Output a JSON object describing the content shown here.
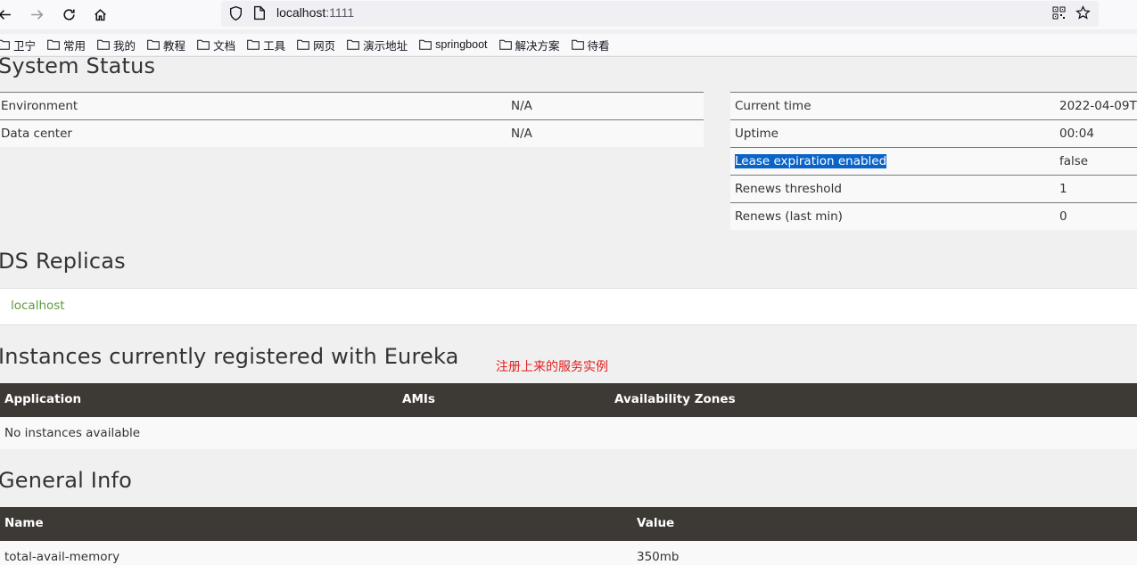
{
  "browser": {
    "url_host": "localhost",
    "url_port": ":1111",
    "bookmarks": [
      "卫宁",
      "常用",
      "我的",
      "教程",
      "文档",
      "工具",
      "网页",
      "演示地址",
      "springboot",
      "解决方案",
      "待看"
    ]
  },
  "system_status": {
    "title": "System Status",
    "left_rows": [
      {
        "key": "Environment",
        "value": "N/A"
      },
      {
        "key": "Data center",
        "value": "N/A"
      }
    ],
    "right_rows": [
      {
        "key": "Current time",
        "value": "2022-04-09T"
      },
      {
        "key": "Uptime",
        "value": "00:04"
      },
      {
        "key": "Lease expiration enabled",
        "value": "false"
      },
      {
        "key": "Renews threshold",
        "value": "1"
      },
      {
        "key": "Renews (last min)",
        "value": "0"
      }
    ]
  },
  "replicas": {
    "title": "DS Replicas",
    "items": [
      "localhost"
    ]
  },
  "instances": {
    "title": "Instances currently registered with Eureka",
    "annotation": "注册上来的服务实例",
    "columns": [
      "Application",
      "AMIs",
      "Availability Zones"
    ],
    "empty_text": "No instances available"
  },
  "general_info": {
    "title": "General Info",
    "columns": [
      "Name",
      "Value"
    ],
    "rows": [
      {
        "name": "total-avail-memory",
        "value": "350mb"
      }
    ]
  }
}
